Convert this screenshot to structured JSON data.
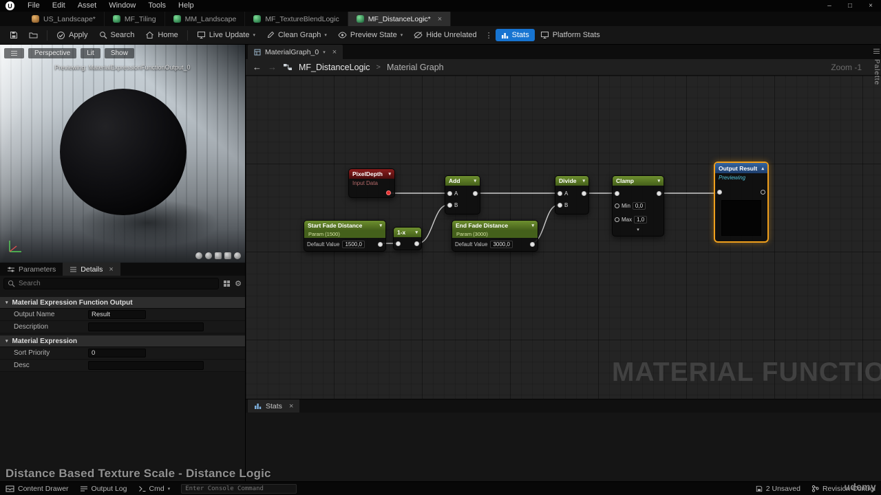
{
  "menubar": {
    "logo": "U",
    "menus": [
      "File",
      "Edit",
      "Asset",
      "Window",
      "Tools",
      "Help"
    ]
  },
  "asset_tabs": [
    {
      "label": "US_Landscape*"
    },
    {
      "label": "MF_Tiling"
    },
    {
      "label": "MM_Landscape"
    },
    {
      "label": "MF_TextureBlendLogic"
    },
    {
      "label": "MF_DistanceLogic*"
    }
  ],
  "toolbar": {
    "apply": "Apply",
    "search": "Search",
    "home": "Home",
    "live_update": "Live Update",
    "clean_graph": "Clean Graph",
    "preview_state": "Preview State",
    "hide_unrelated": "Hide Unrelated",
    "stats": "Stats",
    "platform_stats": "Platform Stats"
  },
  "viewport": {
    "perspective": "Perspective",
    "lit": "Lit",
    "show": "Show",
    "previewing": "Previewing: MaterialExpressionFunctionOutput_0"
  },
  "details": {
    "tab_parameters": "Parameters",
    "tab_details": "Details",
    "search_placeholder": "Search",
    "section_output": "Material Expression Function Output",
    "output_name_label": "Output Name",
    "output_name_value": "Result",
    "description_label": "Description",
    "description_value": "",
    "section_expression": "Material Expression",
    "sort_priority_label": "Sort Priority",
    "sort_priority_value": "0",
    "desc_label": "Desc",
    "desc_value": ""
  },
  "graph": {
    "doc_tab": "MaterialGraph_0",
    "breadcrumb_root": "MF_DistanceLogic",
    "breadcrumb_sep": ">",
    "breadcrumb_current": "Material Graph",
    "zoom_label": "Zoom -1",
    "watermark": "MATERIAL FUNCTION",
    "palette_label": "Palette",
    "stats_tab": "Stats",
    "nodes": {
      "pixel_depth": {
        "title": "PixelDepth",
        "subtitle": "Input Data"
      },
      "add": {
        "title": "Add",
        "pin_a": "A",
        "pin_b": "B"
      },
      "divide": {
        "title": "Divide",
        "pin_a": "A",
        "pin_b": "B"
      },
      "clamp": {
        "title": "Clamp",
        "min_label": "Min",
        "min_value": "0,0",
        "max_label": "Max",
        "max_value": "1,0"
      },
      "output_result": {
        "title": "Output Result",
        "subtitle": "Previewing"
      },
      "start_fade": {
        "title": "Start Fade Distance",
        "subtitle": "Param (1500)",
        "default_label": "Default Value",
        "default_value": "1500,0"
      },
      "one_minus": {
        "title": "1-x"
      },
      "end_fade": {
        "title": "End Fade Distance",
        "subtitle": "Param (3000)",
        "default_label": "Default Value",
        "default_value": "3000,0"
      }
    }
  },
  "caption": "Distance Based Texture Scale - Distance Logic",
  "statusbar": {
    "content_drawer": "Content Drawer",
    "output_log": "Output Log",
    "cmd": "Cmd",
    "console_placeholder": "Enter Console Command",
    "unsaved": "2 Unsaved",
    "revision_control": "Revision Control"
  },
  "watermark_brand": "udemy",
  "colors": {
    "accent_blue": "#1774d1",
    "selection_orange": "#f0a01c",
    "node_green": "#5d7f26",
    "node_red": "#6e1414",
    "node_blue": "#2a5183"
  }
}
